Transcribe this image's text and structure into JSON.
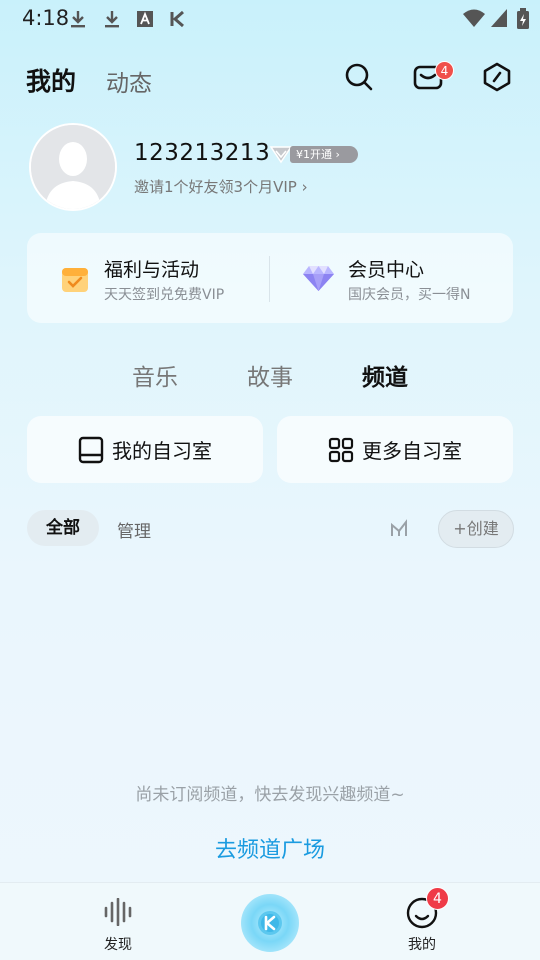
{
  "status_bar": {
    "time": "4:18",
    "icons": [
      "download-icon",
      "download-icon",
      "font-a-icon",
      "k-app-icon",
      "wifi-icon",
      "signal-icon",
      "battery-icon"
    ]
  },
  "header": {
    "tabs": [
      {
        "label": "我的",
        "active": true
      },
      {
        "label": "动态",
        "active": false
      }
    ],
    "message_badge": "4"
  },
  "profile": {
    "username": "123213213",
    "vip_button": "¥1开通 ›",
    "invite_text": "邀请1个好友领3个月VIP ›"
  },
  "feature_card": {
    "items": [
      {
        "title": "福利与活动",
        "subtitle": "天天签到兑免费VIP",
        "icon": "calendar-check-icon"
      },
      {
        "title": "会员中心",
        "subtitle": "国庆会员，买一得N",
        "icon": "diamond-icon"
      }
    ]
  },
  "content_tabs": [
    {
      "label": "音乐",
      "active": false
    },
    {
      "label": "故事",
      "active": false
    },
    {
      "label": "频道",
      "active": true
    }
  ],
  "study_rooms": {
    "my_room": "我的自习室",
    "more_rooms": "更多自习室"
  },
  "filters": {
    "all": "全部",
    "manage": "管理",
    "create": "+创建"
  },
  "empty_state": {
    "message": "尚未订阅频道，快去发现兴趣频道~",
    "link": "去频道广场"
  },
  "bottom_nav": {
    "items": [
      {
        "label": "发现",
        "icon": "waveform-icon"
      },
      {
        "label": "",
        "icon": "k-disc-icon"
      },
      {
        "label": "我的",
        "icon": "smile-face-icon"
      }
    ],
    "badge": "4"
  },
  "colors": {
    "accent_link": "#1a9be0",
    "badge_red": "#ef3b47"
  }
}
